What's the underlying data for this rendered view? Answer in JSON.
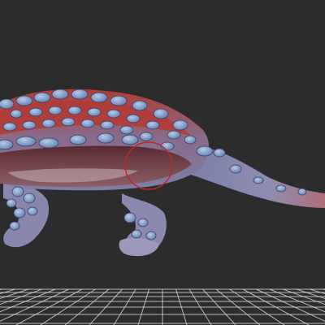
{
  "viewport": {
    "background": "#2c2c2c",
    "grid_color": "#e6e6e6",
    "cursor_color": "#c0262c"
  },
  "model": {
    "palette": {
      "skin_base": "#7d7fa8",
      "skin_light": "#a6a4c4",
      "back_red": "#b33a32",
      "back_dark": "#7e2a2a",
      "belly_dark": "#5a2a32",
      "belly_light": "#c8b3b8",
      "osteoderm": "#5f7fb0",
      "osteoderm_highlight": "#b9cbe6"
    },
    "icon": "ankylosaur-model"
  }
}
